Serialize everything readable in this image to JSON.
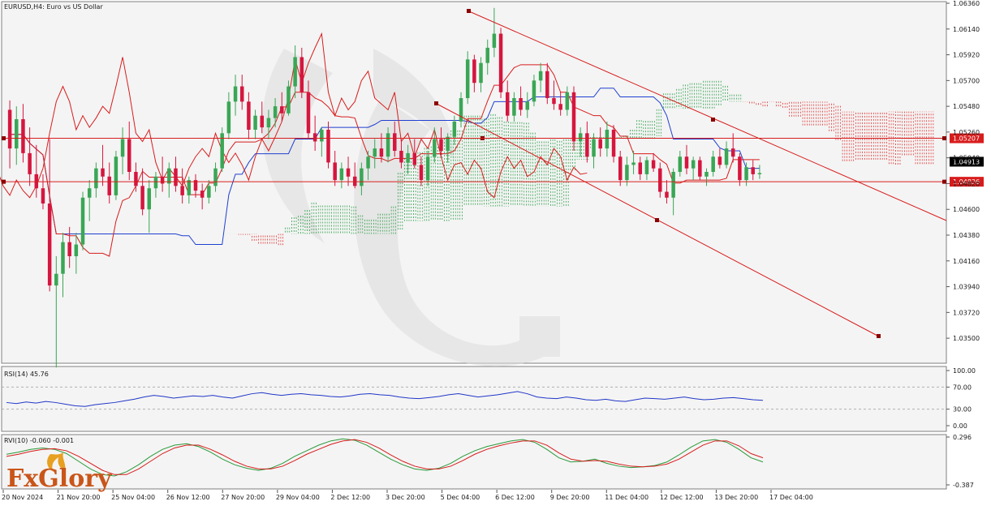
{
  "chart_header": "EURUSD,H4:  Euro vs US Dollar",
  "colors": {
    "background": "#f4f4f4",
    "bull": "#3aa655",
    "bear": "#d5163e",
    "kijun": "#1f3fd0",
    "tenkan": "#d81c1c",
    "cloud_bear": "#e03030",
    "cloud_bull": "#2ea04a",
    "trendline": "#d81c1c",
    "rsi": "#2036c8",
    "rvi_main": "#2a9a3a",
    "rvi_signal": "#d81c1c",
    "watermark": "#d7d7d7"
  },
  "chart_data": [
    {
      "type": "candlestick",
      "symbol": "EURUSD",
      "timeframe": "H4",
      "ylim": [
        1.033,
        1.0636
      ],
      "y_ticks": [
        "1.06360",
        "1.06140",
        "1.05920",
        "1.05700",
        "1.05480",
        "1.05260",
        "1.05040",
        "1.04820",
        "1.04600",
        "1.04380",
        "1.04160",
        "1.03940",
        "1.03720",
        "1.03500"
      ],
      "x_labels": [
        "20 Nov 2024",
        "21 Nov 20:00",
        "25 Nov 04:00",
        "26 Nov 12:00",
        "27 Nov 20:00",
        "29 Nov 04:00",
        "2 Dec 12:00",
        "3 Dec 20:00",
        "5 Dec 04:00",
        "6 Dec 12:00",
        "9 Dec 20:00",
        "11 Dec 04:00",
        "12 Dec 12:00",
        "13 Dec 20:00",
        "17 Dec 04:00"
      ],
      "current_price": "1.04913",
      "levels": [
        {
          "price": 1.05207,
          "label": "1.05207"
        },
        {
          "price": 1.04836,
          "label": "1.04836"
        }
      ],
      "ohlc": [
        [
          1.0545,
          1.0553,
          1.0495,
          1.0512
        ],
        [
          1.0512,
          1.0548,
          1.0498,
          1.0537
        ],
        [
          1.0537,
          1.055,
          1.05,
          1.0508
        ],
        [
          1.0508,
          1.053,
          1.048,
          1.049
        ],
        [
          1.049,
          1.0515,
          1.047,
          1.0478
        ],
        [
          1.0478,
          1.049,
          1.046,
          1.0465
        ],
        [
          1.0465,
          1.052,
          1.039,
          1.0395
        ],
        [
          1.0395,
          1.042,
          1.0325,
          1.0405
        ],
        [
          1.0405,
          1.044,
          1.0385,
          1.0432
        ],
        [
          1.0432,
          1.0445,
          1.041,
          1.042
        ],
        [
          1.042,
          1.044,
          1.0405,
          1.043
        ],
        [
          1.043,
          1.0475,
          1.0425,
          1.047
        ],
        [
          1.047,
          1.0485,
          1.045,
          1.0478
        ],
        [
          1.0478,
          1.05,
          1.047,
          1.0495
        ],
        [
          1.0495,
          1.0515,
          1.048,
          1.0488
        ],
        [
          1.0488,
          1.05,
          1.0465,
          1.0472
        ],
        [
          1.0472,
          1.051,
          1.0468,
          1.0505
        ],
        [
          1.0505,
          1.053,
          1.049,
          1.052
        ],
        [
          1.052,
          1.0535,
          1.0485,
          1.0492
        ],
        [
          1.0492,
          1.05,
          1.0475,
          1.048
        ],
        [
          1.048,
          1.0495,
          1.0455,
          1.046
        ],
        [
          1.046,
          1.0485,
          1.044,
          1.0478
        ],
        [
          1.0478,
          1.0492,
          1.047,
          1.0488
        ],
        [
          1.0488,
          1.0505,
          1.0475,
          1.0482
        ],
        [
          1.0482,
          1.05,
          1.047,
          1.0495
        ],
        [
          1.0495,
          1.0505,
          1.0475,
          1.048
        ],
        [
          1.048,
          1.0495,
          1.0465,
          1.0472
        ],
        [
          1.0472,
          1.0488,
          1.0465,
          1.0485
        ],
        [
          1.0485,
          1.049,
          1.047,
          1.0476
        ],
        [
          1.0476,
          1.0482,
          1.046,
          1.047
        ],
        [
          1.047,
          1.0485,
          1.0465,
          1.048
        ],
        [
          1.048,
          1.05,
          1.0475,
          1.0495
        ],
        [
          1.0495,
          1.053,
          1.0492,
          1.0525
        ],
        [
          1.0525,
          1.056,
          1.052,
          1.0552
        ],
        [
          1.0552,
          1.0575,
          1.054,
          1.0565
        ],
        [
          1.0565,
          1.0575,
          1.0545,
          1.0552
        ],
        [
          1.0552,
          1.056,
          1.052,
          1.0528
        ],
        [
          1.0528,
          1.0545,
          1.052,
          1.054
        ],
        [
          1.054,
          1.0552,
          1.0525,
          1.053
        ],
        [
          1.053,
          1.0545,
          1.052,
          1.0538
        ],
        [
          1.0538,
          1.0555,
          1.053,
          1.0548
        ],
        [
          1.0548,
          1.056,
          1.0535,
          1.0542
        ],
        [
          1.0542,
          1.057,
          1.054,
          1.0565
        ],
        [
          1.0565,
          1.06,
          1.0555,
          1.059
        ],
        [
          1.059,
          1.0598,
          1.0555,
          1.056
        ],
        [
          1.056,
          1.057,
          1.052,
          1.0525
        ],
        [
          1.0525,
          1.054,
          1.051,
          1.0518
        ],
        [
          1.0518,
          1.053,
          1.0505,
          1.0528
        ],
        [
          1.0528,
          1.0535,
          1.0495,
          1.05
        ],
        [
          1.05,
          1.051,
          1.048,
          1.0485
        ],
        [
          1.0485,
          1.05,
          1.0478,
          1.0495
        ],
        [
          1.0495,
          1.0505,
          1.048,
          1.0488
        ],
        [
          1.0488,
          1.05,
          1.0478,
          1.048
        ],
        [
          1.048,
          1.05,
          1.0472,
          1.0495
        ],
        [
          1.0495,
          1.051,
          1.0485,
          1.0505
        ],
        [
          1.0505,
          1.052,
          1.0495,
          1.0512
        ],
        [
          1.0512,
          1.0525,
          1.05,
          1.0505
        ],
        [
          1.0505,
          1.053,
          1.05,
          1.0525
        ],
        [
          1.0525,
          1.0535,
          1.0505,
          1.051
        ],
        [
          1.051,
          1.052,
          1.0495,
          1.05
        ],
        [
          1.05,
          1.0515,
          1.049,
          1.0508
        ],
        [
          1.0508,
          1.052,
          1.0495,
          1.0498
        ],
        [
          1.0498,
          1.0505,
          1.048,
          1.0485
        ],
        [
          1.0485,
          1.051,
          1.048,
          1.0505
        ],
        [
          1.0505,
          1.053,
          1.05,
          1.052
        ],
        [
          1.052,
          1.053,
          1.0505,
          1.051
        ],
        [
          1.051,
          1.0525,
          1.05,
          1.0522
        ],
        [
          1.0522,
          1.054,
          1.0515,
          1.0535
        ],
        [
          1.0535,
          1.056,
          1.053,
          1.0555
        ],
        [
          1.0555,
          1.0595,
          1.055,
          1.0588
        ],
        [
          1.0588,
          1.0592,
          1.056,
          1.0568
        ],
        [
          1.0568,
          1.059,
          1.056,
          1.0585
        ],
        [
          1.0585,
          1.0605,
          1.0575,
          1.0598
        ],
        [
          1.0598,
          1.0632,
          1.059,
          1.061
        ],
        [
          1.061,
          1.0615,
          1.0555,
          1.056
        ],
        [
          1.056,
          1.057,
          1.0535,
          1.054
        ],
        [
          1.054,
          1.056,
          1.0535,
          1.0555
        ],
        [
          1.0555,
          1.0565,
          1.054,
          1.0545
        ],
        [
          1.0545,
          1.056,
          1.0538,
          1.0552
        ],
        [
          1.0552,
          1.0575,
          1.0548,
          1.057
        ],
        [
          1.057,
          1.0585,
          1.056,
          1.0578
        ],
        [
          1.0578,
          1.0585,
          1.055,
          1.0555
        ],
        [
          1.0555,
          1.057,
          1.0545,
          1.055
        ],
        [
          1.055,
          1.056,
          1.054,
          1.0545
        ],
        [
          1.0545,
          1.0565,
          1.054,
          1.056
        ],
        [
          1.056,
          1.0565,
          1.051,
          1.0518
        ],
        [
          1.0518,
          1.053,
          1.0505,
          1.0525
        ],
        [
          1.0525,
          1.0535,
          1.05,
          1.0505
        ],
        [
          1.0505,
          1.0525,
          1.0495,
          1.052
        ],
        [
          1.052,
          1.053,
          1.0505,
          1.0512
        ],
        [
          1.0512,
          1.0535,
          1.0505,
          1.0528
        ],
        [
          1.0528,
          1.0532,
          1.05,
          1.0505
        ],
        [
          1.0505,
          1.051,
          1.048,
          1.0485
        ],
        [
          1.0485,
          1.0505,
          1.048,
          1.0498
        ],
        [
          1.0498,
          1.051,
          1.049,
          1.05
        ],
        [
          1.05,
          1.0505,
          1.0485,
          1.049
        ],
        [
          1.049,
          1.0505,
          1.0485,
          1.0502
        ],
        [
          1.0502,
          1.0508,
          1.0492,
          1.0495
        ],
        [
          1.0495,
          1.05,
          1.047,
          1.0475
        ],
        [
          1.0475,
          1.0485,
          1.0465,
          1.047
        ],
        [
          1.047,
          1.0495,
          1.0455,
          1.0492
        ],
        [
          1.0492,
          1.051,
          1.0488,
          1.0505
        ],
        [
          1.0505,
          1.0515,
          1.049,
          1.0495
        ],
        [
          1.0495,
          1.0505,
          1.0485,
          1.0502
        ],
        [
          1.0502,
          1.0505,
          1.0485,
          1.0488
        ],
        [
          1.0488,
          1.0495,
          1.048,
          1.0492
        ],
        [
          1.0492,
          1.051,
          1.0488,
          1.0505
        ],
        [
          1.0505,
          1.0512,
          1.0495,
          1.0498
        ],
        [
          1.0498,
          1.0518,
          1.0495,
          1.0512
        ],
        [
          1.0512,
          1.0525,
          1.05,
          1.0505
        ],
        [
          1.0505,
          1.0508,
          1.048,
          1.0485
        ],
        [
          1.0485,
          1.05,
          1.048,
          1.0496
        ],
        [
          1.0496,
          1.0502,
          1.0485,
          1.049
        ],
        [
          1.049,
          1.0498,
          1.0486,
          1.0491
        ]
      ]
    },
    {
      "type": "line",
      "name": "RSI(14) 45.76",
      "ylim": [
        0,
        100
      ],
      "y_ticks": [
        "100.00",
        "70.00",
        "30.00",
        "0.00"
      ],
      "values": [
        42,
        40,
        43,
        41,
        44,
        42,
        39,
        36,
        35,
        38,
        40,
        42,
        45,
        48,
        52,
        55,
        53,
        50,
        52,
        54,
        53,
        55,
        52,
        50,
        54,
        58,
        60,
        57,
        55,
        57,
        58,
        56,
        55,
        53,
        52,
        54,
        57,
        58,
        56,
        55,
        52,
        50,
        49,
        51,
        53,
        56,
        58,
        55,
        52,
        54,
        56,
        59,
        62,
        58,
        52,
        50,
        49,
        52,
        50,
        47,
        46,
        48,
        45,
        44,
        47,
        50,
        49,
        48,
        50,
        52,
        49,
        47,
        48,
        50,
        51,
        49,
        47,
        46
      ]
    },
    {
      "type": "line",
      "name": "RVI(10) -0.060 -0.001",
      "ylim": [
        -0.387,
        0.296
      ],
      "y_ticks": [
        "0.296",
        "-0.387"
      ],
      "series": [
        {
          "values": [
            0.05,
            0.08,
            0.12,
            0.14,
            0.12,
            0.06,
            -0.05,
            -0.16,
            -0.24,
            -0.26,
            -0.2,
            -0.1,
            0.02,
            0.12,
            0.18,
            0.2,
            0.16,
            0.08,
            -0.02,
            -0.1,
            -0.15,
            -0.18,
            -0.15,
            -0.08,
            0.02,
            0.1,
            0.18,
            0.24,
            0.27,
            0.25,
            0.18,
            0.08,
            -0.02,
            -0.1,
            -0.16,
            -0.18,
            -0.15,
            -0.08,
            0.02,
            0.1,
            0.16,
            0.2,
            0.24,
            0.26,
            0.22,
            0.12,
            0.0,
            -0.06,
            -0.05,
            -0.02,
            -0.08,
            -0.12,
            -0.14,
            -0.13,
            -0.11,
            -0.06,
            0.04,
            0.15,
            0.24,
            0.26,
            0.22,
            0.12,
            0.0,
            -0.06
          ]
        },
        {
          "values": [
            0.02,
            0.05,
            0.09,
            0.12,
            0.13,
            0.1,
            0.02,
            -0.08,
            -0.18,
            -0.24,
            -0.24,
            -0.16,
            -0.05,
            0.06,
            0.14,
            0.18,
            0.18,
            0.12,
            0.04,
            -0.05,
            -0.12,
            -0.16,
            -0.16,
            -0.12,
            -0.04,
            0.05,
            0.12,
            0.19,
            0.24,
            0.26,
            0.22,
            0.14,
            0.04,
            -0.05,
            -0.12,
            -0.16,
            -0.16,
            -0.12,
            -0.04,
            0.05,
            0.12,
            0.17,
            0.21,
            0.24,
            0.24,
            0.18,
            0.07,
            -0.02,
            -0.05,
            -0.04,
            -0.05,
            -0.09,
            -0.12,
            -0.13,
            -0.12,
            -0.09,
            -0.02,
            0.08,
            0.18,
            0.24,
            0.24,
            0.17,
            0.06,
            -0.001
          ]
        }
      ]
    }
  ],
  "indicator_titles": {
    "rsi": "RSI(14) 45.76",
    "rvi": "RVI(10) -0.060 -0.001"
  },
  "logo": "FxGlory"
}
